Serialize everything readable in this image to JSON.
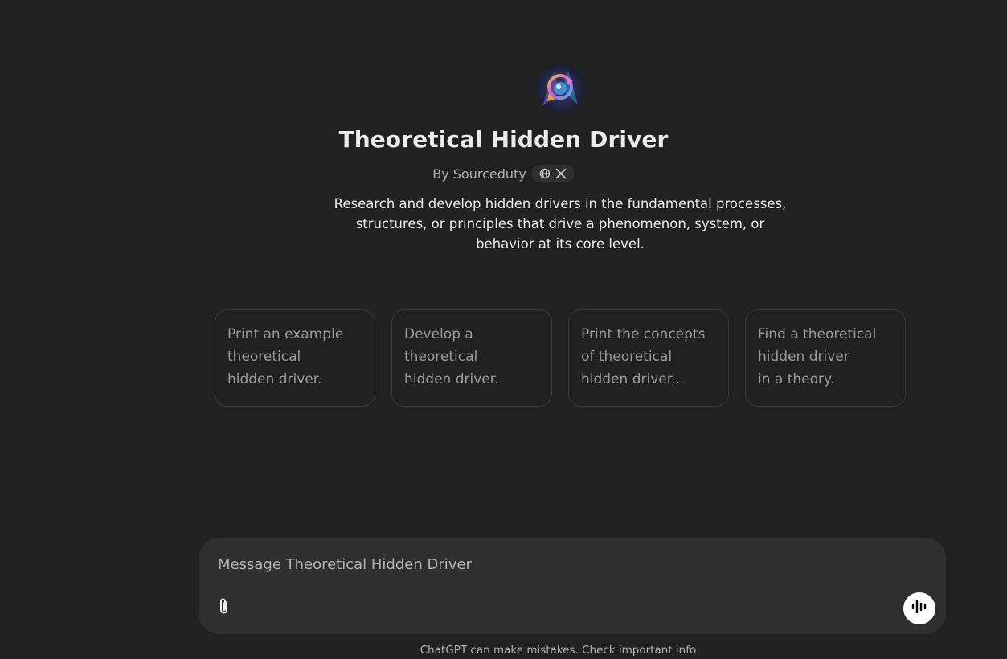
{
  "gpt": {
    "name": "Theoretical Hidden Driver",
    "byline": "By Sourceduty",
    "description": "Research and develop hidden drivers in the fundamental processes, structures, or principles that drive a phenomenon, system, or behavior at its core level.",
    "link_icons": [
      "globe-icon",
      "x-logo-icon"
    ]
  },
  "starters": [
    {
      "text": "Print an example\ntheoretical\nhidden driver."
    },
    {
      "text": "Develop a\ntheoretical\nhidden driver."
    },
    {
      "text": "Print the concepts\nof theoretical\nhidden driver..."
    },
    {
      "text": "Find a theoretical\nhidden driver\nin a theory."
    }
  ],
  "composer": {
    "placeholder": "Message Theoretical Hidden Driver",
    "attach_icon": "paperclip-icon",
    "voice_icon": "voice-waveform-icon"
  },
  "footer": {
    "disclaimer": "ChatGPT can make mistakes. Check important info."
  },
  "colors": {
    "background": "#212121",
    "composer": "#2f2f2f",
    "border": "#3a3a3a",
    "text": "#ececec",
    "muted": "#b4b4b4"
  }
}
